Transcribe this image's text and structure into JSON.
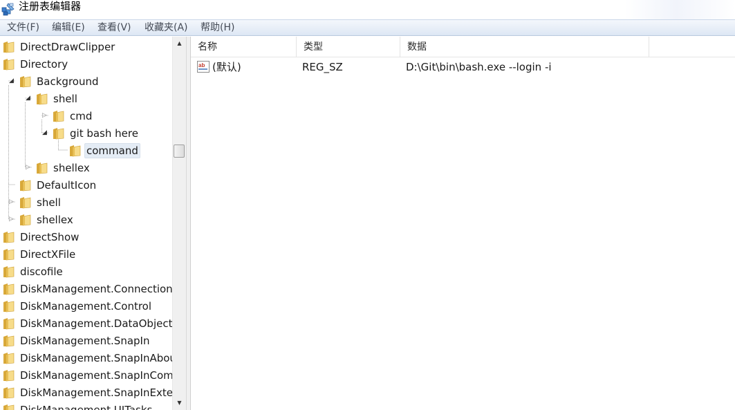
{
  "window": {
    "title": "注册表编辑器"
  },
  "menu": [
    "文件(F)",
    "编辑(E)",
    "查看(V)",
    "收藏夹(A)",
    "帮助(H)"
  ],
  "tree": {
    "items": [
      {
        "label": "DirectDrawClipper",
        "level": 0,
        "expander": "none"
      },
      {
        "label": "Directory",
        "level": 0,
        "expander": "none"
      },
      {
        "label": "Background",
        "level": 1,
        "expander": "expanded"
      },
      {
        "label": "shell",
        "level": 2,
        "expander": "expanded"
      },
      {
        "label": "cmd",
        "level": 3,
        "expander": "collapsed"
      },
      {
        "label": "git bash here",
        "level": 3,
        "expander": "expanded"
      },
      {
        "label": "command",
        "level": 4,
        "expander": "none",
        "selected": true
      },
      {
        "label": "shellex",
        "level": 2,
        "expander": "collapsed"
      },
      {
        "label": "DefaultIcon",
        "level": 1,
        "expander": "none"
      },
      {
        "label": "shell",
        "level": 1,
        "expander": "collapsed"
      },
      {
        "label": "shellex",
        "level": 1,
        "expander": "collapsed"
      },
      {
        "label": "DirectShow",
        "level": 0,
        "expander": "none"
      },
      {
        "label": "DirectXFile",
        "level": 0,
        "expander": "none"
      },
      {
        "label": "discofile",
        "level": 0,
        "expander": "none"
      },
      {
        "label": "DiskManagement.Connection",
        "level": 0,
        "expander": "none"
      },
      {
        "label": "DiskManagement.Control",
        "level": 0,
        "expander": "none"
      },
      {
        "label": "DiskManagement.DataObject",
        "level": 0,
        "expander": "none"
      },
      {
        "label": "DiskManagement.SnapIn",
        "level": 0,
        "expander": "none"
      },
      {
        "label": "DiskManagement.SnapInAbou",
        "level": 0,
        "expander": "none"
      },
      {
        "label": "DiskManagement.SnapInComp",
        "level": 0,
        "expander": "none"
      },
      {
        "label": "DiskManagement.SnapInExten",
        "level": 0,
        "expander": "none"
      },
      {
        "label": "DiskManagement.UITasks",
        "level": 0,
        "expander": "none"
      }
    ]
  },
  "list": {
    "columns": [
      "名称",
      "类型",
      "数据"
    ],
    "rows": [
      {
        "name": "(默认)",
        "type": "REG_SZ",
        "data": "D:\\Git\\bin\\bash.exe --login -i",
        "icon": "reg-sz-icon"
      }
    ]
  },
  "icons": {
    "folder": "folder-icon",
    "expanded": "triangle-expanded-icon",
    "collapsed": "triangle-collapsed-icon",
    "app": "registry-editor-icon",
    "value": "reg-sz-icon"
  },
  "colors": {
    "menubar_top": "#f4f7fc",
    "menubar_bottom": "#dde7f4",
    "folder_light": "#f7dc8a",
    "folder_dark": "#d9a93a",
    "selection": "#e4ecf5"
  }
}
